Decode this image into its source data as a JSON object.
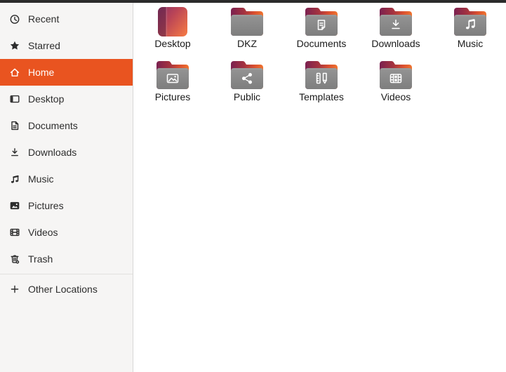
{
  "topbar": {
    "color": "#2b2b2b"
  },
  "sidebar": {
    "selected_color": "#e95420",
    "items": [
      {
        "label": "Recent",
        "icon": "recent",
        "selected": false
      },
      {
        "label": "Starred",
        "icon": "starred",
        "selected": false
      },
      {
        "label": "Home",
        "icon": "home",
        "selected": true
      },
      {
        "label": "Desktop",
        "icon": "desktop",
        "selected": false
      },
      {
        "label": "Documents",
        "icon": "documents",
        "selected": false
      },
      {
        "label": "Downloads",
        "icon": "downloads",
        "selected": false
      },
      {
        "label": "Music",
        "icon": "music",
        "selected": false
      },
      {
        "label": "Pictures",
        "icon": "pictures",
        "selected": false
      },
      {
        "label": "Videos",
        "icon": "videos",
        "selected": false
      },
      {
        "label": "Trash",
        "icon": "trash",
        "selected": false
      }
    ],
    "other_locations": {
      "label": "Other Locations",
      "icon": "plus"
    }
  },
  "main": {
    "items": [
      {
        "name": "Desktop",
        "icon": "desktop-gradient",
        "emblem": null
      },
      {
        "name": "DKZ",
        "icon": "folder",
        "emblem": null
      },
      {
        "name": "Documents",
        "icon": "folder",
        "emblem": "documents"
      },
      {
        "name": "Downloads",
        "icon": "folder",
        "emblem": "downloads"
      },
      {
        "name": "Music",
        "icon": "folder",
        "emblem": "music"
      },
      {
        "name": "Pictures",
        "icon": "folder",
        "emblem": "pictures"
      },
      {
        "name": "Public",
        "icon": "folder",
        "emblem": "share"
      },
      {
        "name": "Templates",
        "icon": "folder",
        "emblem": "templates"
      },
      {
        "name": "Videos",
        "icon": "folder",
        "emblem": "videos"
      }
    ]
  },
  "colors": {
    "accent_orange": "#e95420",
    "sidebar_bg": "#f6f5f4",
    "topbar": "#2b2b2b",
    "folder_body_gray_top": "#949494",
    "folder_body_gray_bottom": "#7e7e7e",
    "folder_tab_purple": "#7b2150",
    "folder_tab_red": "#c24238",
    "folder_tab_orange": "#f0742e",
    "desktop_icon_purple": "#8d3166",
    "desktop_icon_orange": "#ef7446"
  }
}
